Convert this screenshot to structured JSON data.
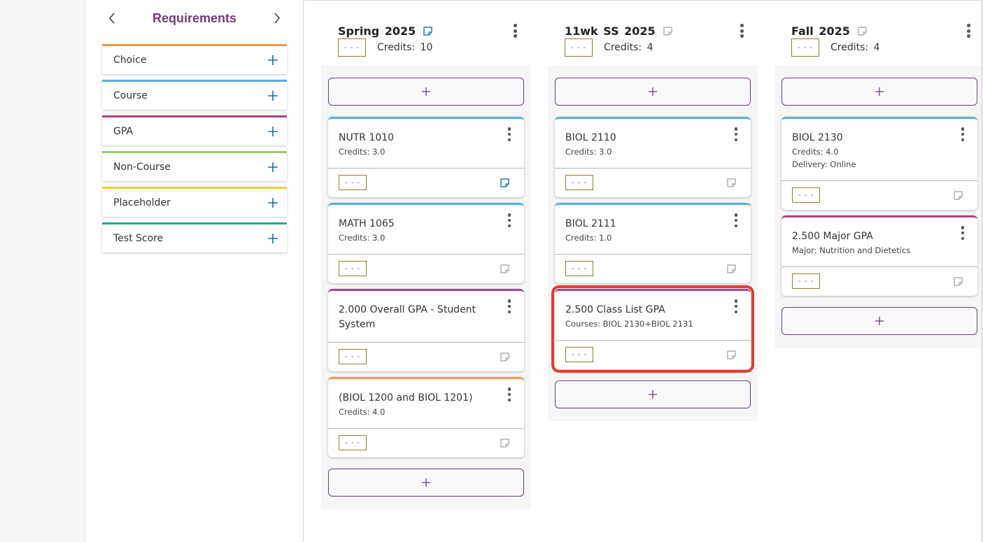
{
  "requirements_panel": {
    "title": "Requirements",
    "prev_icon": "chevron-left-icon",
    "next_icon": "chevron-right-icon",
    "items": [
      {
        "label": "Choice",
        "color": "#eb9a4c"
      },
      {
        "label": "Course",
        "color": "#5aaed6"
      },
      {
        "label": "GPA",
        "color": "#a3468c"
      },
      {
        "label": "Non-Course",
        "color": "#9ccc6a"
      },
      {
        "label": "Placeholder",
        "color": "#f0cc3c"
      },
      {
        "label": "Test Score",
        "color": "#2aa88f"
      }
    ]
  },
  "terms": [
    {
      "title": "Spring 2025",
      "grade": "- - -",
      "credits_label": "Credits:",
      "credits": "10",
      "has_note": true,
      "cards": [
        {
          "title": "NUTR 1010",
          "lines": [
            "Credits: 3.0"
          ],
          "type": "course",
          "grade": "- - -",
          "has_note": true
        },
        {
          "title": "MATH 1065",
          "lines": [
            "Credits: 3.0"
          ],
          "type": "course",
          "grade": "- - -",
          "has_note": false
        },
        {
          "title": "2.000 Overall GPA - Student System",
          "lines": [],
          "type": "gpa",
          "grade": "- - -",
          "has_note": false
        },
        {
          "title": "(BIOL 1200 and BIOL 1201)",
          "lines": [
            "Credits: 4.0"
          ],
          "type": "choice",
          "grade": "- - -",
          "has_note": false
        }
      ]
    },
    {
      "title": "11wk SS 2025",
      "grade": "- - -",
      "credits_label": "Credits:",
      "credits": "4",
      "has_note": false,
      "cards": [
        {
          "title": "BIOL 2110",
          "lines": [
            "Credits: 3.0"
          ],
          "type": "course",
          "grade": "- - -",
          "has_note": false
        },
        {
          "title": "BIOL 2111",
          "lines": [
            "Credits: 1.0"
          ],
          "type": "course",
          "grade": "- - -",
          "has_note": false
        },
        {
          "title": "2.500 Class List GPA",
          "lines": [
            "Courses: BIOL 2130+BIOL 2131"
          ],
          "type": "gpa",
          "grade": "- - -",
          "has_note": false,
          "highlighted": true
        }
      ]
    },
    {
      "title": "Fall 2025",
      "grade": "- - -",
      "credits_label": "Credits:",
      "credits": "4",
      "has_note": false,
      "cards": [
        {
          "title": "BIOL 2130",
          "lines": [
            "Credits: 4.0",
            "Delivery: Online"
          ],
          "type": "course",
          "grade": "- - -",
          "has_note": false
        },
        {
          "title": "2.500 Major GPA",
          "lines": [
            "Major: Nutrition and Dietetics"
          ],
          "type": "gpa",
          "grade": "- - -",
          "has_note": false
        }
      ]
    }
  ],
  "colors": {
    "accent_purple": "#6b3f7a",
    "plus_teal": "#1f6e8c",
    "note_active": "#1f78b4",
    "note_inactive": "#b0b0b0",
    "highlight_red": "#e53b32"
  }
}
